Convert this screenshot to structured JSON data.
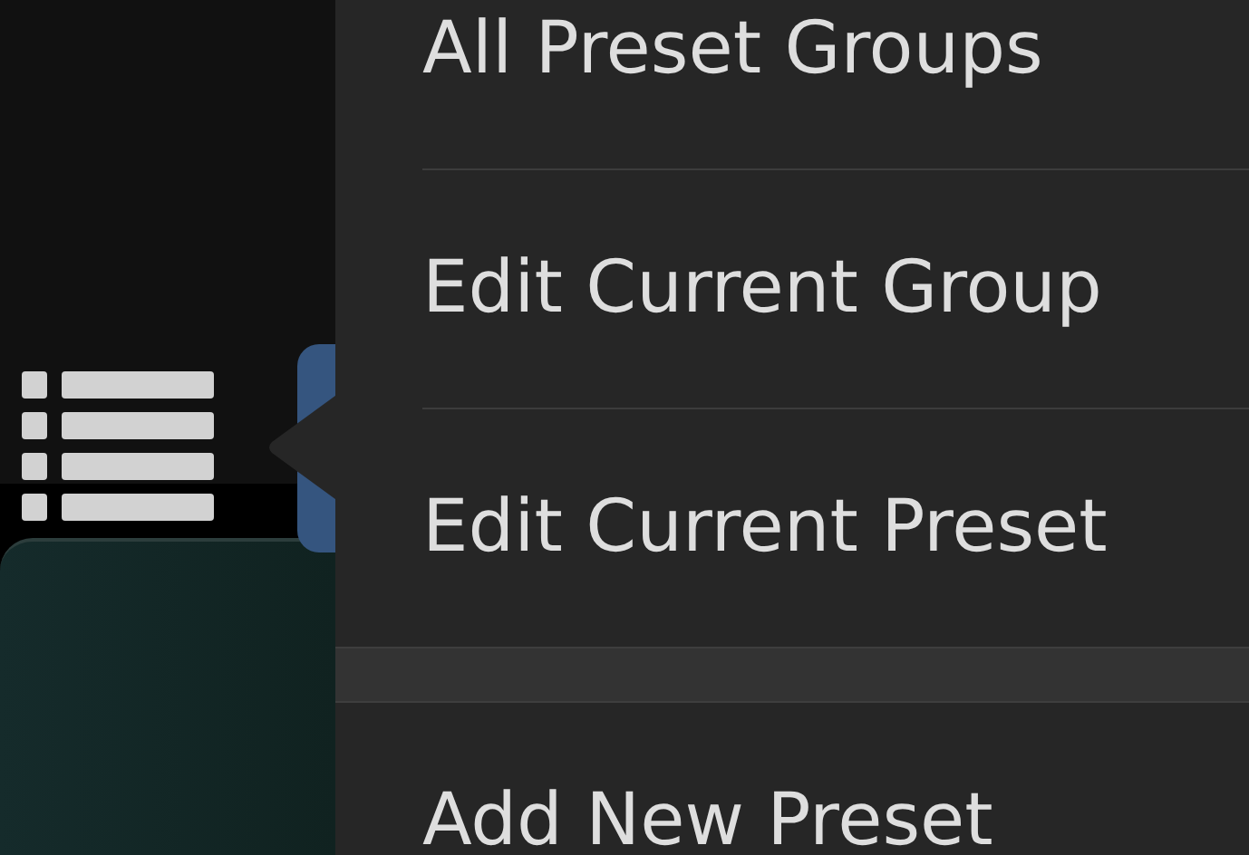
{
  "menu": {
    "sections": [
      {
        "items": [
          {
            "label": "All Preset Groups"
          },
          {
            "label": "Edit Current Group"
          },
          {
            "label": "Edit Current Preset"
          }
        ]
      },
      {
        "items": [
          {
            "label": "Add New Preset"
          }
        ]
      }
    ]
  }
}
